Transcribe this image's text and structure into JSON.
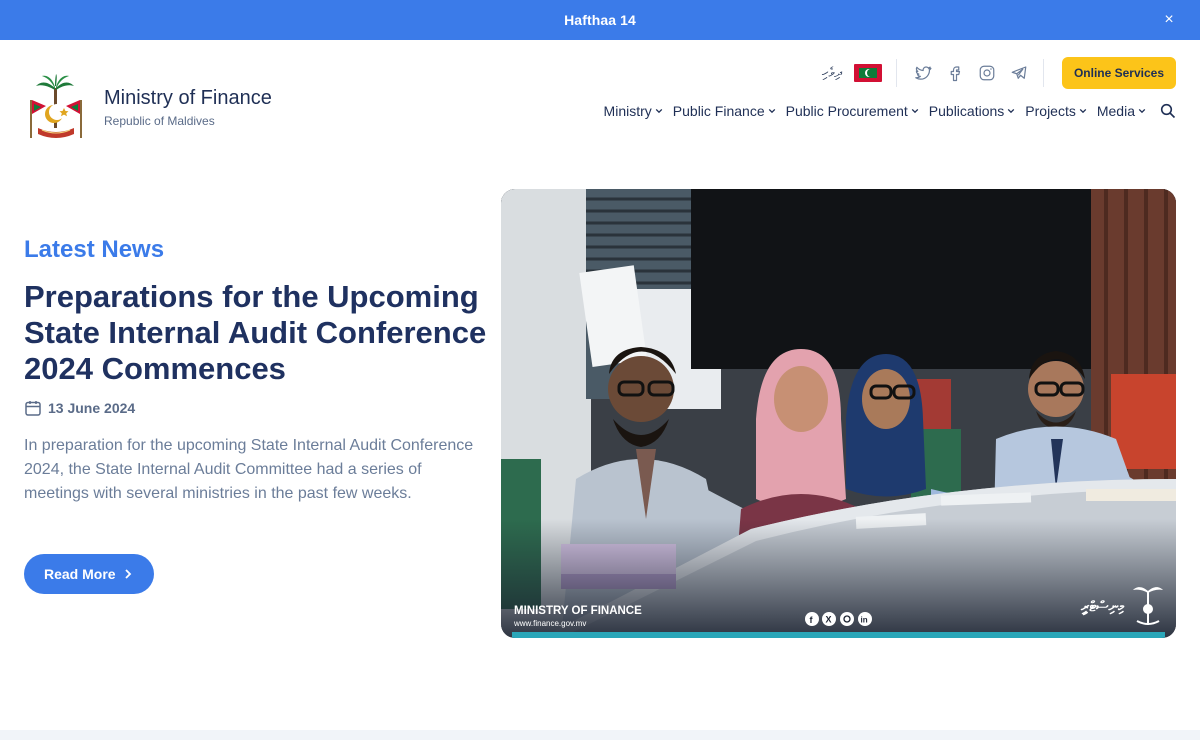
{
  "announcement": {
    "text": "Hafthaa 14",
    "close_icon": "×"
  },
  "brand": {
    "title": "Ministry of Finance",
    "subtitle": "Republic of Maldives",
    "logo": "maldives-emblem-icon"
  },
  "toprow": {
    "language": "ދިވެހި",
    "social": [
      "twitter-icon",
      "facebook-icon",
      "instagram-icon",
      "telegram-icon"
    ],
    "online_services": "Online Services"
  },
  "nav": {
    "items": [
      {
        "label": "Ministry"
      },
      {
        "label": "Public Finance"
      },
      {
        "label": "Public Procurement"
      },
      {
        "label": "Publications"
      },
      {
        "label": "Projects"
      },
      {
        "label": "Media"
      }
    ]
  },
  "hero": {
    "section_label": "Latest News",
    "headline": "Preparations for the Upcoming State Internal Audit Conference 2024 Commences",
    "date": "13 June 2024",
    "excerpt": "In preparation for the upcoming State Internal Audit Conference 2024, the State Internal Audit Committee had a series of meetings with several ministries in the past few weeks.",
    "read_more": "Read More",
    "image": {
      "caption_title": "MINISTRY OF FINANCE",
      "caption_url": "www.finance.gov.mv",
      "caption_dhivehi": "މިނިސްޓްރީ"
    }
  },
  "colors": {
    "primary": "#3b7be9",
    "navy": "#1f3160",
    "accent": "#fcc419",
    "muted": "#6b7d99"
  }
}
